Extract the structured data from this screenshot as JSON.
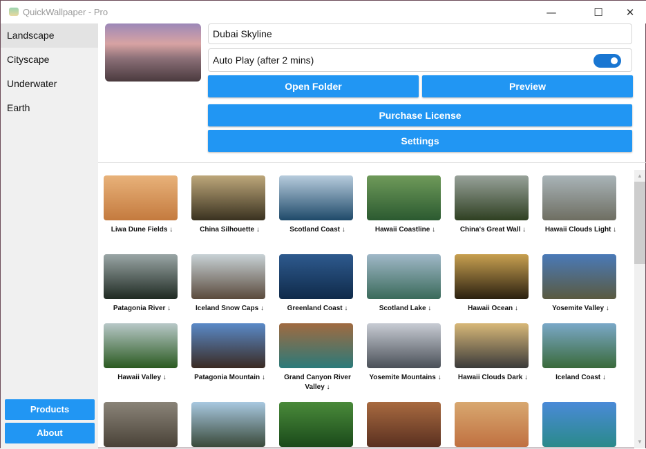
{
  "window": {
    "title": "QuickWallpaper - Pro",
    "minimize": "—",
    "maximize": "☐",
    "close": "✕"
  },
  "sidebar": {
    "items": [
      {
        "label": "Landscape"
      },
      {
        "label": "Cityscape"
      },
      {
        "label": "Underwater"
      },
      {
        "label": "Earth"
      }
    ],
    "products_label": "Products",
    "about_label": "About"
  },
  "main": {
    "current_wallpaper": "Dubai Skyline",
    "auto_play_label": "Auto Play (after 2 mins)",
    "auto_play_on": true,
    "open_folder_label": "Open Folder",
    "preview_label": "Preview",
    "purchase_label": "Purchase License",
    "settings_label": "Settings"
  },
  "scrollbar": {
    "up": "▲",
    "down": "▼"
  },
  "wallpapers": [
    {
      "name": "Liwa Dune Fields ↓",
      "c1": "#e8b27a",
      "c2": "#c47a3e"
    },
    {
      "name": "China Silhouette ↓",
      "c1": "#bda77a",
      "c2": "#3a3220"
    },
    {
      "name": "Scotland Coast ↓",
      "c1": "#b7ccdd",
      "c2": "#1f4a6a"
    },
    {
      "name": "Hawaii Coastline ↓",
      "c1": "#6f9a5a",
      "c2": "#2b5a30"
    },
    {
      "name": "China's Great Wall ↓",
      "c1": "#98a29a",
      "c2": "#2f4022"
    },
    {
      "name": "Hawaii Clouds Light ↓",
      "c1": "#a9b4b8",
      "c2": "#6e6e62"
    },
    {
      "name": "Patagonia River ↓",
      "c1": "#9aa6a6",
      "c2": "#1f2a22"
    },
    {
      "name": "Iceland Snow Caps ↓",
      "c1": "#c8d2d6",
      "c2": "#5a4a3c"
    },
    {
      "name": "Greenland Coast ↓",
      "c1": "#2e5a8e",
      "c2": "#0f2a4a"
    },
    {
      "name": "Scotland Lake ↓",
      "c1": "#a0b8c8",
      "c2": "#3a6a5a"
    },
    {
      "name": "Hawaii Ocean ↓",
      "c1": "#c8a050",
      "c2": "#2a2010"
    },
    {
      "name": "Yosemite Valley ↓",
      "c1": "#4a7ab8",
      "c2": "#5a5a40"
    },
    {
      "name": "Hawaii Valley ↓",
      "c1": "#b8c8c8",
      "c2": "#2a5a20"
    },
    {
      "name": "Patagonia Mountain ↓",
      "c1": "#5a8ac8",
      "c2": "#3a2a22"
    },
    {
      "name": "Grand Canyon River Valley ↓",
      "c1": "#a06a40",
      "c2": "#2a7a7a"
    },
    {
      "name": "Yosemite Mountains ↓",
      "c1": "#c8ccd4",
      "c2": "#4a5058"
    },
    {
      "name": "Hawaii Clouds Dark ↓",
      "c1": "#d8b878",
      "c2": "#3a3a3a"
    },
    {
      "name": "Iceland Coast ↓",
      "c1": "#7aa8c8",
      "c2": "#3a6a3a"
    },
    {
      "name": "",
      "c1": "#8a8478",
      "c2": "#4a4238"
    },
    {
      "name": "",
      "c1": "#a8c8e0",
      "c2": "#3a4a3a"
    },
    {
      "name": "",
      "c1": "#4a8a3a",
      "c2": "#1a4a1a"
    },
    {
      "name": "",
      "c1": "#a86a40",
      "c2": "#5a3020"
    },
    {
      "name": "",
      "c1": "#d8a870",
      "c2": "#c07040"
    },
    {
      "name": "",
      "c1": "#4a8ad8",
      "c2": "#2a8a8a"
    }
  ]
}
